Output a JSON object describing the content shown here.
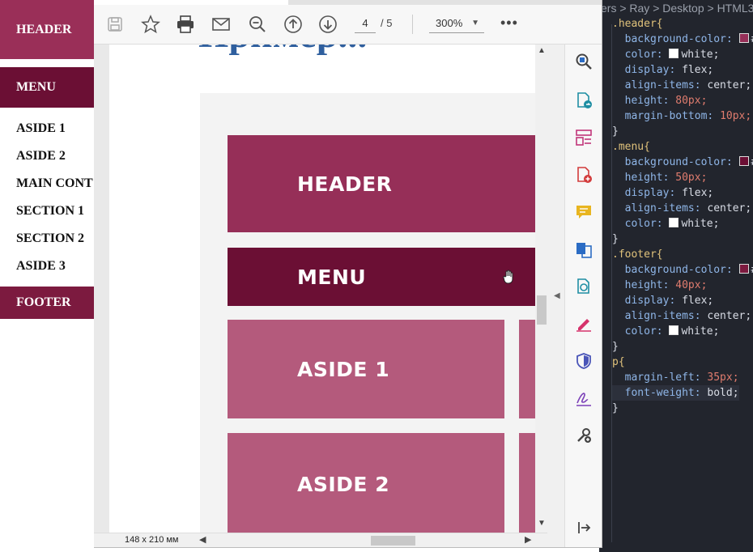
{
  "web": {
    "header": "HEADER",
    "menu": "MENU",
    "items": [
      "ASIDE 1",
      "ASIDE 2",
      "MAIN CONT",
      "SECTION 1",
      "SECTION 2",
      "ASIDE 3"
    ],
    "footer": "FOOTER"
  },
  "pdf": {
    "page_current": "4",
    "page_total": "/ 5",
    "zoom": "300%",
    "more": "•••",
    "page_size": "148 x 210 мм",
    "title_fragment": "Пример...",
    "blocks": {
      "header": "HEADER",
      "menu": "MENU",
      "aside1": "ASIDE 1",
      "aside2": "ASIDE 2"
    },
    "toolbar_icons": [
      "save-icon",
      "star-icon",
      "print-icon",
      "email-icon",
      "zoom-out-icon",
      "page-up-icon",
      "page-down-icon"
    ],
    "tool_icons": [
      "search-tool-icon",
      "export-pdf-icon",
      "organize-pages-icon",
      "create-pdf-icon",
      "comment-icon",
      "combine-files-icon",
      "edit-pdf-icon",
      "fill-sign-icon",
      "protect-icon",
      "signature-icon",
      "more-tools-icon",
      "expand-panel-icon"
    ]
  },
  "editor": {
    "breadcrumb": "ers > Ray > Desktop > HTML3",
    "lines": [
      {
        "sel": ".header{"
      },
      {
        "prop": "background-color:",
        "swatch": "#962f58",
        "val": "#"
      },
      {
        "prop": "color:",
        "swatch": "#ffffff",
        "val": "white;"
      },
      {
        "prop": "display:",
        "val": "flex;"
      },
      {
        "prop": "align-items:",
        "val": "center;"
      },
      {
        "prop": "height:",
        "num": "80px;"
      },
      {
        "prop": "margin-bottom:",
        "num": "10px;"
      },
      {
        "close": "}"
      },
      {
        "sel": ".menu{"
      },
      {
        "prop": "background-color:",
        "swatch": "#6b0f34",
        "val": "#"
      },
      {
        "prop": "height:",
        "num": "50px;"
      },
      {
        "prop": "display:",
        "val": "flex;"
      },
      {
        "prop": "align-items:",
        "val": "center;"
      },
      {
        "prop": "color:",
        "swatch": "#ffffff",
        "val": "white;"
      },
      {
        "close": "}"
      },
      {
        "sel": ".footer{"
      },
      {
        "prop": "background-color:",
        "swatch": "#7c1a3f",
        "val": "#"
      },
      {
        "prop": "height:",
        "num": "40px;"
      },
      {
        "prop": "display:",
        "val": "flex;"
      },
      {
        "prop": "align-items:",
        "val": "center;"
      },
      {
        "prop": "color:",
        "swatch": "#ffffff",
        "val": "white;"
      },
      {
        "close": "}"
      },
      {
        "sel": "p{"
      },
      {
        "prop": "margin-left:",
        "num": "35px;"
      },
      {
        "prop": "font-weight:",
        "val": "bold;"
      },
      {
        "close": "}"
      }
    ]
  },
  "colors": {
    "header": "#962f58",
    "menu": "#6b0f34",
    "aside": "#b45a7c",
    "footer": "#7c1a3f",
    "editor_bg": "#22252d"
  }
}
